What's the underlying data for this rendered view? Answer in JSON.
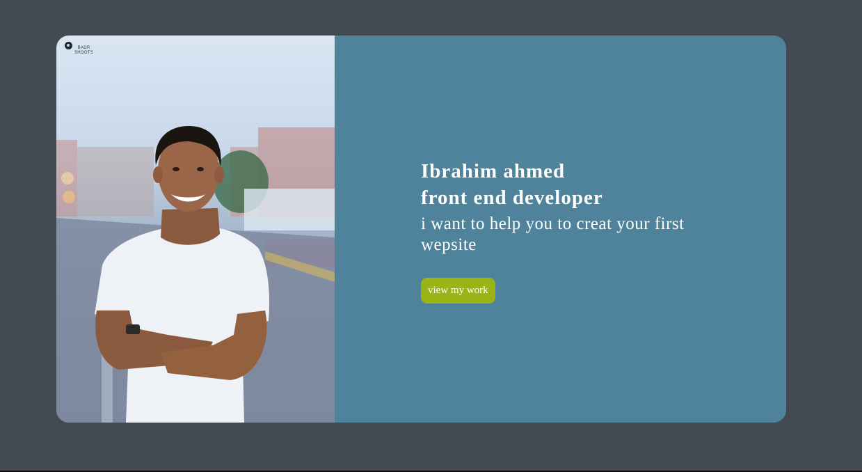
{
  "photo": {
    "watermark_line1": "BADR",
    "watermark_line2": "SHOOTS",
    "watermark_icon": "camera-logo-icon"
  },
  "hero": {
    "name": "Ibrahim ahmed",
    "role": "front end developer",
    "tagline": "i want to help you to creat your first wepsite",
    "cta_label": "view my work"
  },
  "colors": {
    "page_background": "#434a52",
    "card_background": "#4e839b",
    "button_background": "#9ab416",
    "text": "#ffffff"
  }
}
